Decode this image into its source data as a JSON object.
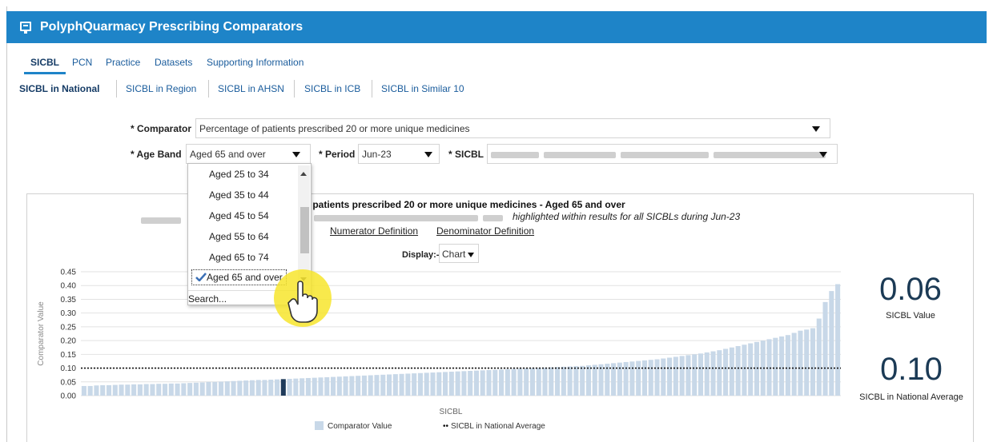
{
  "app": {
    "title": "PolyphQuarmacy Prescribing Comparators"
  },
  "tabs": [
    "SICBL",
    "PCN",
    "Practice",
    "Datasets",
    "Supporting Information"
  ],
  "subtabs": [
    "SICBL in National",
    "SICBL in Region",
    "SICBL in AHSN",
    "SICBL in ICB",
    "SICBL in Similar 10"
  ],
  "form": {
    "comparator_label": "* Comparator",
    "comparator_value": "Percentage of patients prescribed 20 or more unique medicines",
    "age_band_label": "* Age Band",
    "age_band_value": "Aged 65 and over",
    "period_label": "* Period",
    "period_value": "Jun-23",
    "sicbl_label": "* SICBL"
  },
  "age_band_options": [
    "Aged 25 to 34",
    "Aged 35 to 44",
    "Aged 45 to 54",
    "Aged 55 to 64",
    "Aged 65 to 74",
    "Aged 65 and over"
  ],
  "search_label": "Search...",
  "chart_header": {
    "title": "f patients prescribed 20 or more unique medicines - Aged 65 and over",
    "subtitle": "highlighted within results for all SICBLs during Jun-23",
    "numerator_link": "Numerator Definition",
    "denominator_link": "Denominator Definition",
    "display_label": "Display:-",
    "display_value": "Chart"
  },
  "kpis": {
    "sicbl_value": "0.06",
    "sicbl_value_caption": "SICBL Value",
    "national_avg": "0.10",
    "national_avg_caption": "SICBL in National Average"
  },
  "colors": {
    "bar": "#c8d8e8",
    "highlight": "#1f3b5a",
    "header": "#1e84c8"
  },
  "chart_data": {
    "type": "bar",
    "xlabel": "SICBL",
    "ylabel": "Comparator Value",
    "ylim": [
      0,
      0.45
    ],
    "yticks": [
      "0.00",
      "0.05",
      "0.10",
      "0.15",
      "0.20",
      "0.25",
      "0.30",
      "0.35",
      "0.40",
      "0.45"
    ],
    "grid": true,
    "legend": "bottom",
    "series": [
      {
        "name": "Comparator Value",
        "type": "bar",
        "values": [
          0.035,
          0.035,
          0.037,
          0.038,
          0.038,
          0.039,
          0.04,
          0.04,
          0.041,
          0.041,
          0.042,
          0.042,
          0.043,
          0.043,
          0.044,
          0.044,
          0.045,
          0.046,
          0.047,
          0.048,
          0.05,
          0.05,
          0.051,
          0.052,
          0.053,
          0.054,
          0.055,
          0.056,
          0.057,
          0.057,
          0.058,
          0.059,
          0.06,
          0.061,
          0.062,
          0.063,
          0.064,
          0.065,
          0.066,
          0.067,
          0.068,
          0.069,
          0.07,
          0.071,
          0.072,
          0.073,
          0.074,
          0.075,
          0.076,
          0.077,
          0.078,
          0.079,
          0.08,
          0.081,
          0.082,
          0.083,
          0.084,
          0.085,
          0.086,
          0.087,
          0.088,
          0.089,
          0.09,
          0.091,
          0.092,
          0.093,
          0.094,
          0.095,
          0.096,
          0.097,
          0.098,
          0.099,
          0.1,
          0.101,
          0.102,
          0.103,
          0.104,
          0.105,
          0.106,
          0.107,
          0.108,
          0.11,
          0.112,
          0.114,
          0.116,
          0.118,
          0.12,
          0.122,
          0.124,
          0.126,
          0.128,
          0.13,
          0.132,
          0.135,
          0.138,
          0.141,
          0.144,
          0.147,
          0.15,
          0.153,
          0.157,
          0.161,
          0.165,
          0.17,
          0.175,
          0.18,
          0.185,
          0.19,
          0.195,
          0.2,
          0.205,
          0.21,
          0.215,
          0.22,
          0.228,
          0.236,
          0.24,
          0.245,
          0.28,
          0.34,
          0.38,
          0.405
        ],
        "highlight_index": 32
      },
      {
        "name": "SICBL in National Average",
        "type": "line",
        "value": 0.1
      }
    ]
  }
}
